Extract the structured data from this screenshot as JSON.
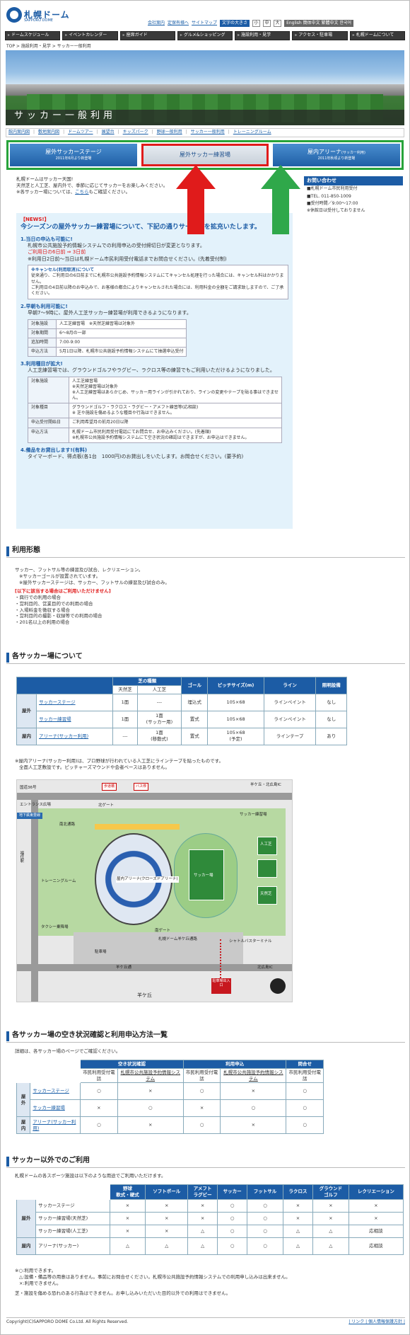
{
  "header": {
    "logo_text": "札幌ドーム",
    "logo_sub": "SAPPORO DOME",
    "util_links": [
      "会社案内",
      "定保有様へ",
      "サイトマップ"
    ],
    "text_size_label": "文字の大きさ",
    "size_small": "小",
    "size_mid": "中",
    "size_large": "大",
    "lang_links": "English  簡体中文  繁體中文  한국어"
  },
  "gnav": [
    "ドームスケジュール",
    "イベントカレンダー",
    "座席ガイド",
    "グルメ&ショッピング",
    "施設利用・見学",
    "アクセス・駐車場",
    "札幌ドームについて"
  ],
  "breadcrumb": "TOP > 施設利用・見学 > サッカー一般利用",
  "hero_title": "サッカー一般利用",
  "subnav": [
    "館内案内図",
    "敷地案内図",
    "ドームツアー",
    "展望台",
    "キッズパーク",
    "野球一般利用",
    "サッカー一般利用",
    "トレーニングルーム"
  ],
  "tabs": [
    {
      "label": "屋外サッカーステージ",
      "sub": "2011年6月より新登場"
    },
    {
      "label": "屋外サッカー練習場",
      "sub": ""
    },
    {
      "label": "屋内アリーナ",
      "small": "(サッカー利用)",
      "sub": "2011年秋頃より新登場"
    }
  ],
  "intro": {
    "l1": "札幌ドームはサッカー天国!",
    "l2": "天然芝と人工芝、屋内外で、季節に応じてサッカーをお楽しみください。",
    "l3a": "※各サッカー場については、",
    "l3link": "こちら",
    "l3b": "もご確認ください。"
  },
  "side": {
    "title": "お問い合わせ",
    "l1": "■札幌ドーム市民利用受付",
    "l2": "■TEL. 011-850-1009",
    "l3": "■受付時間／9:00～17:00",
    "l4": "※休館日は受付しておりません"
  },
  "news": {
    "tag": "【NEWS!】",
    "lead": "今シーズンの屋外サッカー練習場について、下記の通りサービスを拡充いたします。",
    "h1": "1.当日の申込も可能に!",
    "p1": "札幌市公共施設予約情報システムでの利用申込の受付締切日が変更となります。",
    "p1r": "ご利用日の6日前 ⇒ 3日前",
    "p1b": "※利用日2日前～当日は札幌ドーム市民利用受付電話までお問合せください。(先着受付制)",
    "note_t": "※キャンセル(利用取消)について",
    "note1": "従来通り、ご利用日の6日前までに札幌市公共施設予約情報システムにてキャンセル処理を行った場合には、キャンセル料はかかりません。",
    "note2": "ご利用日の4日前以降のお申込みで、お客様の都合によりキャンセルされた場合には、利用料金の全額をご請求致しますので、ご了承ください。",
    "h2": "2.早朝も利用可能に!",
    "p2": "早朝7～9時に、屋外人工芝サッカー練習場が利用できるようになります。",
    "t2": [
      [
        "対象施設",
        "人工芝練習場　※天然芝練習場は対象外"
      ],
      [
        "対象期間",
        "6～8月の一部"
      ],
      [
        "追加時間",
        "7:00-9:00"
      ],
      [
        "申込方法",
        "5月1日以降、札幌市公共施設予約情報システムにて抽選申込受付"
      ]
    ],
    "h3": "3.利用種目が拡大!",
    "p3": "人工芝練習場では、グラウンドゴルフやラグビー、ラクロス等の練習でもご利用いただけるようになりました。",
    "t3": [
      [
        "対象施設",
        "人工芝練習場\n※天然芝練習場は対象外\n※人工芝練習場はあらかじめ、サッカー用ラインが引かれており、ラインの変更やテープを貼る事はできません。"
      ],
      [
        "対象種目",
        "グラウンドゴルフ・ラクロス・ラグビー・アメフト練習等(応相談)\n※ 芝や施設を傷めるような種目や行為はできません。"
      ],
      [
        "申込受付開始日",
        "ご利用希望月の前月20日以降"
      ],
      [
        "申込方法",
        "札幌ドーム市民利用受付電話にてお問合せ、お申込みください。(先着順)\n※札幌市公共施設予約情報システムにて空き状況の確認はできますが、お申込はできません。"
      ]
    ],
    "h4": "4.備品をお貸出します!(有料)",
    "p4": "タイマーボード、得点板(各1台　1000円)のお貸出しをいたします。お問合せください。(要予約)"
  },
  "s1": {
    "title": "利用形態",
    "l1": "サッカー、フットサル等の練習及び試合、レクリエーション。",
    "l2": "※サッカーゴールが設置されています。",
    "l3": "※屋外サッカーステージは、サッカー、フットサルの練習及び試合のみ。",
    "red": "[以下に該当する場合はご利用いただけません]",
    "items": [
      "・興行での利用の場合",
      "・営利目的、営業目的での利用の場合",
      "・入場料金を徴収する場合",
      "・営利目的の撮影・収録等での利用の場合",
      "・201名以上の利用の場合"
    ]
  },
  "s2": {
    "title": "各サッカー場について",
    "h_turf": "芝の種類",
    "h_nat": "天然芝",
    "h_art": "人工芝",
    "h_goal": "ゴール",
    "h_size": "ピッチサイズ(m)",
    "h_line": "ライン",
    "h_light": "照明設備",
    "g_out": "屋外",
    "g_in": "屋内",
    "rows": [
      [
        "サッカーステージ",
        "1面",
        "---",
        "埋込式",
        "105×68",
        "ラインペイント",
        "なし"
      ],
      [
        "サッカー練習場",
        "1面",
        "1面\n(サッカー用)",
        "置式",
        "105×68",
        "ラインペイント",
        "なし"
      ],
      [
        "アリーナ(サッカー利用)",
        "---",
        "1面\n(移動式)",
        "置式",
        "105×68\n(予定)",
        "ラインテープ",
        "あり"
      ]
    ],
    "n1": "※屋内アリーナ(サッカー利用)は、プロ野球が行われている人工芝にラインテープを貼ったものです。",
    "n2": "全面人工芝敷設です。ピッチャーズマウンドや会者ベースはありません。"
  },
  "map": {
    "labels": [
      "国道36号",
      "エントランス広場",
      "地下鉄東豊線",
      "福住駅",
      "歩道橋",
      "バス停",
      "北ゲート",
      "南ゲート",
      "南北通路",
      "屋内アリーナ(クローズドアリーナ)",
      "サッカー場",
      "サッカー練習場",
      "人工芝",
      "天然芝",
      "駐車場",
      "羊ケ丘通",
      "羊ケ丘",
      "札幌ドーム羊ケ丘通路",
      "シャトルバスターミナル",
      "トレーニングルーム",
      "タクシー乗降場",
      "羊ケ丘・北広島IC",
      "北広島IC"
    ],
    "exit": "駐車場出入口"
  },
  "s3": {
    "title": "各サッカー場の空き状況確認と利用申込方法一覧",
    "lead": "詳細は、各サッカー場のページでご確認ください。",
    "h_avail": "空き状況確認",
    "h_apply": "利用申込",
    "h_ask": "問合せ",
    "sub": [
      "市民利用受付電話",
      "札幌市公共施設予約情報システム",
      "市民利用受付電話",
      "札幌市公共施設予約情報システム",
      "市民利用受付電話"
    ],
    "rows": [
      [
        "サッカーステージ",
        "○",
        "×",
        "○",
        "×",
        "○"
      ],
      [
        "サッカー練習場",
        "×",
        "○",
        "×",
        "○",
        "○"
      ],
      [
        "アリーナ(サッカー利用)",
        "○",
        "×",
        "○",
        "×",
        "○"
      ]
    ]
  },
  "s4": {
    "title": "サッカー以外でのご利用",
    "lead": "札幌ドームの各スポーツ施設は以下のような用途でご利用いただけます。",
    "cols": [
      "野球\n軟式・硬式",
      "ソフトボール",
      "アメフト\nラグビー",
      "サッカー",
      "フットサル",
      "ラクロス",
      "グラウンド\nゴルフ",
      "レクリエーション"
    ],
    "rows": [
      [
        "サッカーステージ",
        "×",
        "×",
        "×",
        "○",
        "○",
        "×",
        "×",
        "×"
      ],
      [
        "サッカー練習場(天然芝)",
        "×",
        "×",
        "×",
        "○",
        "○",
        "×",
        "×",
        "×"
      ],
      [
        "サッカー練習場(人工芝)",
        "×",
        "×",
        "△",
        "○",
        "○",
        "△",
        "△",
        "応相談"
      ],
      [
        "アリーナ(サッカー)",
        "△",
        "△",
        "△",
        "○",
        "○",
        "△",
        "△",
        "応相談"
      ]
    ],
    "notes": [
      "※○:利用できます。",
      "△:設備・備品等の用意はありません。事前にお問合せください。札幌市公共施設予約情報システムでの利用申し込みは出来ません。",
      "×:利用できません。",
      "芝・施設を傷める恐れのある行為はできません。お申し込みいただいた目的以外での利用はできません。"
    ]
  },
  "footer": {
    "copy": "Copyright(C)SAPPORO DOME Co.Ltd. All Rights Reserved.",
    "links": "| リンク | 個人情報保護方針 |"
  }
}
